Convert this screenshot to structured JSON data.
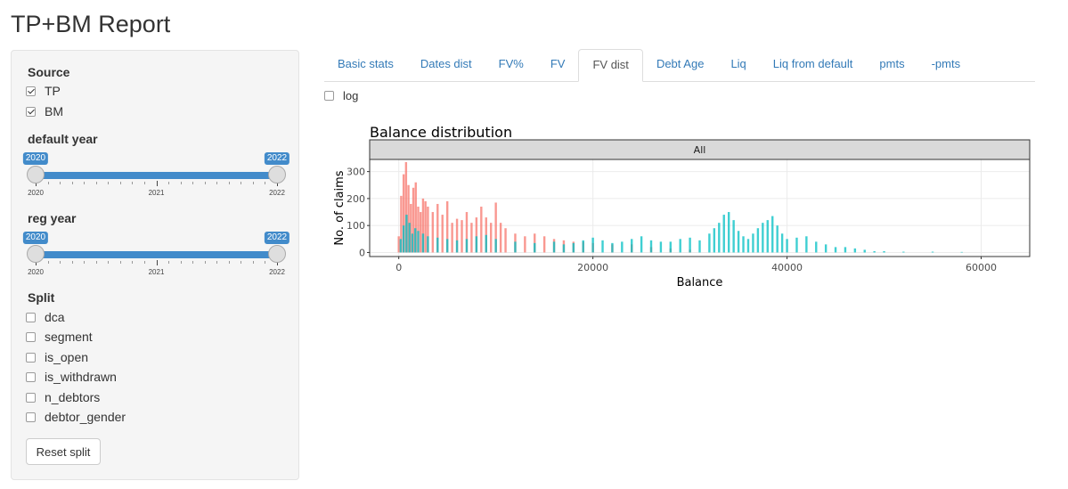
{
  "app": {
    "title": "TP+BM Report"
  },
  "sidebar": {
    "source_label": "Source",
    "sources": [
      {
        "label": "TP",
        "checked": true
      },
      {
        "label": "BM",
        "checked": true
      }
    ],
    "default_year": {
      "label": "default year",
      "min": 2020,
      "max": 2022,
      "from": 2020,
      "to": 2022,
      "from_label": "2020",
      "to_label": "2022",
      "tick_labels": [
        "2020",
        "2021",
        "2022"
      ]
    },
    "reg_year": {
      "label": "reg year",
      "min": 2020,
      "max": 2022,
      "from": 2020,
      "to": 2022,
      "from_label": "2020",
      "to_label": "2022",
      "tick_labels": [
        "2020",
        "2021",
        "2022"
      ]
    },
    "split_label": "Split",
    "splits": [
      {
        "label": "dca",
        "checked": false
      },
      {
        "label": "segment",
        "checked": false
      },
      {
        "label": "is_open",
        "checked": false
      },
      {
        "label": "is_withdrawn",
        "checked": false
      },
      {
        "label": "n_debtors",
        "checked": false
      },
      {
        "label": "debtor_gender",
        "checked": false
      }
    ],
    "reset_label": "Reset split"
  },
  "tabs": [
    {
      "label": "Basic stats",
      "active": false
    },
    {
      "label": "Dates dist",
      "active": false
    },
    {
      "label": "FV%",
      "active": false
    },
    {
      "label": "FV",
      "active": false
    },
    {
      "label": "FV dist",
      "active": true
    },
    {
      "label": "Debt Age",
      "active": false
    },
    {
      "label": "Liq",
      "active": false
    },
    {
      "label": "Liq from default",
      "active": false
    },
    {
      "label": "pmts",
      "active": false
    },
    {
      "label": "-pmts",
      "active": false
    }
  ],
  "log_option": {
    "label": "log",
    "checked": false
  },
  "colors": {
    "accent": "#428bca",
    "link": "#337ab7",
    "series_red": "#F8766D",
    "series_teal": "#00BFC4"
  },
  "chart_data": {
    "type": "bar",
    "title": "Balance distribution",
    "facet_label": "All",
    "xlabel": "Balance",
    "ylabel": "No. of claims",
    "xlim": [
      -3000,
      65000
    ],
    "ylim": [
      -15,
      345
    ],
    "x_ticks": [
      0,
      20000,
      40000,
      60000
    ],
    "x_tick_labels": [
      "0",
      "20000",
      "40000",
      "60000"
    ],
    "y_ticks": [
      0,
      100,
      200,
      300
    ],
    "y_tick_labels": [
      "0",
      "100",
      "200",
      "300"
    ],
    "grid": true,
    "legend": "none",
    "series": [
      {
        "color": "#F8766D",
        "x": [
          0,
          250,
          500,
          750,
          1000,
          1250,
          1500,
          1750,
          2000,
          2250,
          2500,
          2750,
          3000,
          3500,
          4000,
          4500,
          5000,
          5500,
          6000,
          6500,
          7000,
          7500,
          8000,
          8500,
          9000,
          9500,
          10000,
          10500,
          11000,
          12000,
          13000,
          14000,
          15000,
          16000,
          17000,
          18000,
          19000,
          20000,
          22000,
          24000,
          26000,
          28000,
          30000
        ],
        "values": [
          60,
          210,
          290,
          335,
          250,
          180,
          240,
          260,
          170,
          150,
          200,
          190,
          170,
          150,
          180,
          140,
          190,
          110,
          125,
          120,
          150,
          110,
          130,
          170,
          130,
          110,
          185,
          110,
          90,
          70,
          60,
          70,
          60,
          50,
          45,
          40,
          40,
          35,
          30,
          30,
          20,
          15,
          10
        ]
      },
      {
        "color": "#00BFC4",
        "x": [
          200,
          500,
          800,
          1100,
          1400,
          1700,
          2000,
          2500,
          3000,
          4000,
          5000,
          6000,
          7000,
          8000,
          9000,
          10000,
          12000,
          14000,
          16000,
          17000,
          18000,
          19000,
          20000,
          21000,
          22000,
          23000,
          24000,
          25000,
          26000,
          27000,
          28000,
          29000,
          30000,
          31000,
          32000,
          32500,
          33000,
          33500,
          34000,
          34500,
          35000,
          35500,
          36000,
          36500,
          37000,
          37500,
          38000,
          38500,
          39000,
          39500,
          40000,
          41000,
          42000,
          43000,
          44000,
          45000,
          46000,
          47000,
          48000,
          49000,
          50000,
          52000,
          55000,
          58000
        ],
        "values": [
          50,
          100,
          140,
          110,
          70,
          90,
          80,
          70,
          60,
          55,
          50,
          45,
          50,
          60,
          65,
          50,
          40,
          35,
          40,
          30,
          35,
          45,
          55,
          45,
          35,
          40,
          50,
          60,
          45,
          40,
          40,
          50,
          55,
          45,
          70,
          90,
          110,
          140,
          150,
          120,
          80,
          60,
          50,
          70,
          90,
          110,
          120,
          135,
          100,
          70,
          50,
          55,
          60,
          40,
          30,
          20,
          20,
          15,
          10,
          5,
          5,
          3,
          3,
          2
        ]
      }
    ]
  }
}
